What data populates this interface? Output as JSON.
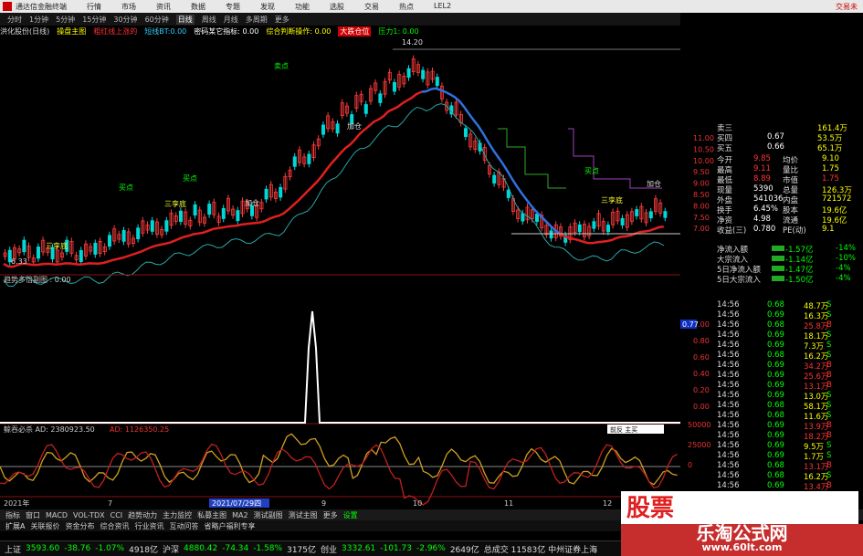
{
  "window": {
    "title": "通达信金融终端",
    "close_label": "交易未"
  },
  "menu": [
    "行情",
    "市场",
    "资讯",
    "数据",
    "专题",
    "发现",
    "功能",
    "选股",
    "交易",
    "热点",
    "LEL2"
  ],
  "periods": [
    "分时",
    "1分钟",
    "5分钟",
    "15分钟",
    "30分钟",
    "60分钟",
    "日线",
    "周线",
    "月线",
    "多周期",
    "更多"
  ],
  "indicator_bar": {
    "name": "洪化股份(日线)",
    "main": "操盘主图",
    "items": [
      "粗红线上涨的",
      "短线BT:0.00",
      "密码某它指标: 0.00",
      "综合判断操作: 0.00",
      "大跌仓位",
      "压力1: 0.00"
    ]
  },
  "price_labels": {
    "high": "14.20",
    "low": "6.33"
  },
  "chart_annotations": [
    "三孪底",
    "三孪底",
    "三孪底",
    "加仓",
    "加仓",
    "加仓",
    "买点",
    "买点",
    "买点",
    "卖点",
    "卖点"
  ],
  "sub1": {
    "title": "趋势多倍副图 : 0.00",
    "axis": [
      "1.00",
      "0.80",
      "0.60",
      "0.40",
      "0.20",
      "0.00"
    ]
  },
  "sub2": {
    "title": "鲸吞必杀 AD: 2380923.50",
    "ad_red": "AD: 1126350.25",
    "box": "前反 主买",
    "axis": [
      "50000",
      "25000",
      "0"
    ]
  },
  "dates": [
    "2021年",
    "7",
    "2021/07/29四",
    "9",
    "10",
    "11",
    "12"
  ],
  "right_price_axis": [
    "11.00",
    "10.50",
    "10.00",
    "9.50",
    "9.00",
    "8.50",
    "8.00",
    "7.50",
    "7.00"
  ],
  "quote": {
    "orders": [
      {
        "label": "卖三",
        "price": "",
        "vol": "161.4万"
      },
      {
        "label": "买四",
        "price": "0.67",
        "vol": "53.5万"
      },
      {
        "label": "买五",
        "price": "0.66",
        "vol": "65.1万"
      }
    ],
    "stats": [
      {
        "l1": "今开",
        "v1": "9.85",
        "l2": "均价",
        "v2": "9.10"
      },
      {
        "l1": "最高",
        "v1": "9.11",
        "l2": "量比",
        "v2": "1.75"
      },
      {
        "l1": "最低",
        "v1": "8.89",
        "l2": "市值",
        "v2": "1.75"
      },
      {
        "l1": "现量",
        "v1": "5390",
        "l2": "总量",
        "v2": "126.3万"
      },
      {
        "l1": "外盘",
        "v1": "541036",
        "l2": "内盘",
        "v2": "721572"
      },
      {
        "l1": "换手",
        "v1": "6.45%",
        "l2": "股本",
        "v2": "19.6亿"
      },
      {
        "l1": "净资",
        "v1": "4.98",
        "l2": "流通",
        "v2": "19.6亿"
      },
      {
        "l1": "收益(三)",
        "v1": "0.780",
        "l2": "PE(动)",
        "v2": "9.1"
      }
    ],
    "flows": [
      {
        "label": "净流入额",
        "val": "-1.57亿",
        "pct": "-14%"
      },
      {
        "label": "大宗流入",
        "val": "-1.14亿",
        "pct": "-10%"
      },
      {
        "label": "5日净流入额",
        "val": "-1.47亿",
        "pct": "-4%"
      },
      {
        "label": "5日大宗流入",
        "val": "-1.50亿",
        "pct": "-4%"
      }
    ],
    "axis_77": "0.77",
    "ticks": [
      {
        "t": "14:56",
        "p": "0.68",
        "v": "48.7万",
        "s": "S"
      },
      {
        "t": "14:56",
        "p": "0.69",
        "v": "16.3万",
        "s": "S"
      },
      {
        "t": "14:56",
        "p": "0.68",
        "v": "25.8万",
        "s": "B"
      },
      {
        "t": "14:56",
        "p": "0.69",
        "v": "18.1万",
        "s": "S"
      },
      {
        "t": "14:56",
        "p": "0.69",
        "v": "7.3万",
        "s": "S"
      },
      {
        "t": "14:56",
        "p": "0.68",
        "v": "16.2万",
        "s": "S"
      },
      {
        "t": "14:56",
        "p": "0.69",
        "v": "34.2万",
        "s": "B"
      },
      {
        "t": "14:56",
        "p": "0.69",
        "v": "25.6万",
        "s": "B"
      },
      {
        "t": "14:56",
        "p": "0.69",
        "v": "13.1万",
        "s": "B"
      },
      {
        "t": "14:56",
        "p": "0.69",
        "v": "13.0万",
        "s": "S"
      },
      {
        "t": "14:56",
        "p": "0.68",
        "v": "58.1万",
        "s": "S"
      },
      {
        "t": "14:56",
        "p": "0.68",
        "v": "11.6万",
        "s": "S"
      },
      {
        "t": "14:56",
        "p": "0.69",
        "v": "13.9万",
        "s": "B"
      },
      {
        "t": "14:56",
        "p": "0.69",
        "v": "18.2万",
        "s": "B"
      },
      {
        "t": "14:56",
        "p": "0.69",
        "v": "9.5万",
        "s": "S"
      },
      {
        "t": "14:56",
        "p": "0.69",
        "v": "1.7万",
        "s": "S"
      },
      {
        "t": "14:56",
        "p": "0.68",
        "v": "13.1万",
        "s": "B"
      },
      {
        "t": "14:56",
        "p": "0.68",
        "v": "16.2万",
        "s": "S"
      },
      {
        "t": "14:56",
        "p": "0.69",
        "v": "13.4万",
        "s": "B"
      }
    ]
  },
  "bottom_tabs": [
    "指标",
    "窗口",
    "MACD",
    "VOL-TDX",
    "CCI",
    "趋势动力",
    "主力监控",
    "私募主图",
    "MA2",
    "测试副图",
    "测试主图",
    "更多",
    "设置"
  ],
  "bottom_tabs2": [
    "扩展A",
    "关联报价",
    "资金分布",
    "综合资讯",
    "行业资讯",
    "互动问答",
    "省略户福利专享"
  ],
  "status": [
    {
      "k": "上证",
      "v": "3593.60",
      "c": "-38.76",
      "p": "-1.07%",
      "a": "4918亿"
    },
    {
      "k": "沪深",
      "v": "4880.42",
      "c": "-74.34",
      "p": "-1.58%",
      "a": "3175亿"
    },
    {
      "k": "创业",
      "v": "3332.61",
      "c": "-101.73",
      "p": "-2.96%",
      "a": "2649亿"
    }
  ],
  "status_extra": "总成交 11583亿 中州证券上海",
  "watermark": {
    "big": "股票",
    "site": "乐淘公式网",
    "url": "www.60lt.com"
  },
  "colors": {
    "up": "#ff3b3b",
    "down": "#00e0e0",
    "ma_red": "#e02020",
    "ma_blue": "#3070e0",
    "yellow": "#ffff00"
  }
}
